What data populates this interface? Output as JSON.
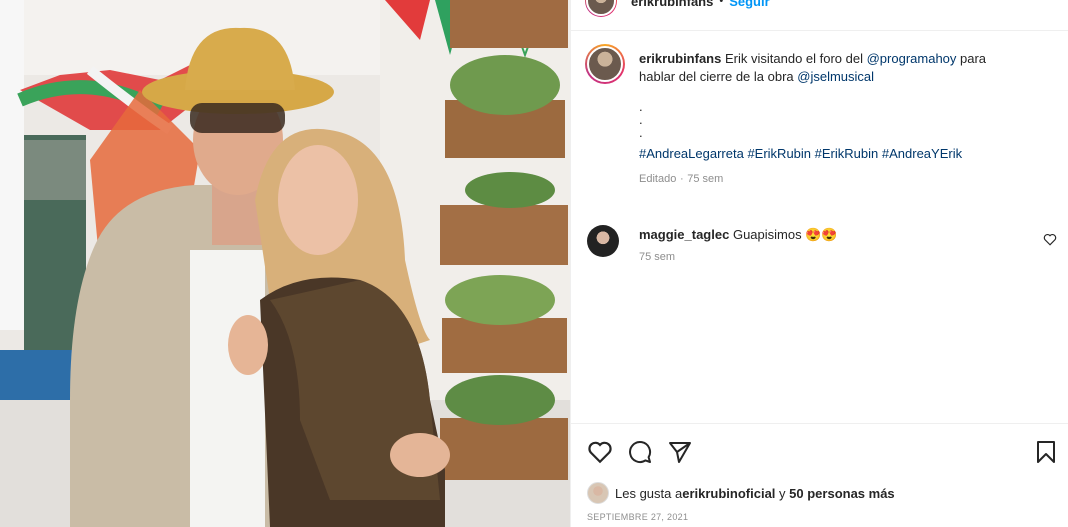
{
  "header": {
    "username": "erikrubinfans",
    "separator": "•",
    "follow_label": "Seguir",
    "more_label": "•••"
  },
  "caption": {
    "username": "erikrubinfans",
    "text_part1": "Erik visitando el foro del ",
    "mention1": "@programahoy",
    "text_part2": " para",
    "line2_text": "hablar del cierre de la obra ",
    "mention2": "@jselmusical",
    "dots": [
      ".",
      ".",
      "."
    ],
    "hashtags": [
      "#AndreaLegarreta",
      "#ErikRubin",
      "#ErikRubin",
      "#AndreaYErik"
    ],
    "edited_label": "Editado",
    "edited_sep": "·",
    "time": "75 sem"
  },
  "comments": [
    {
      "username": "maggie_taglec",
      "text": "Guapisimos",
      "emoji": "😍😍",
      "time": "75 sem"
    }
  ],
  "actions": {
    "like_icon": "heart-icon",
    "comment_icon": "comment-icon",
    "share_icon": "share-icon",
    "save_icon": "bookmark-icon"
  },
  "likes": {
    "prefix": "Les gusta a ",
    "user": "erikrubinoficial",
    "middle": " y ",
    "count_text": "50 personas más"
  },
  "date": "SEPTIEMBRE 27, 2021",
  "colors": {
    "link": "#00376b",
    "follow": "#0095f6",
    "muted": "#8e8e8e"
  }
}
